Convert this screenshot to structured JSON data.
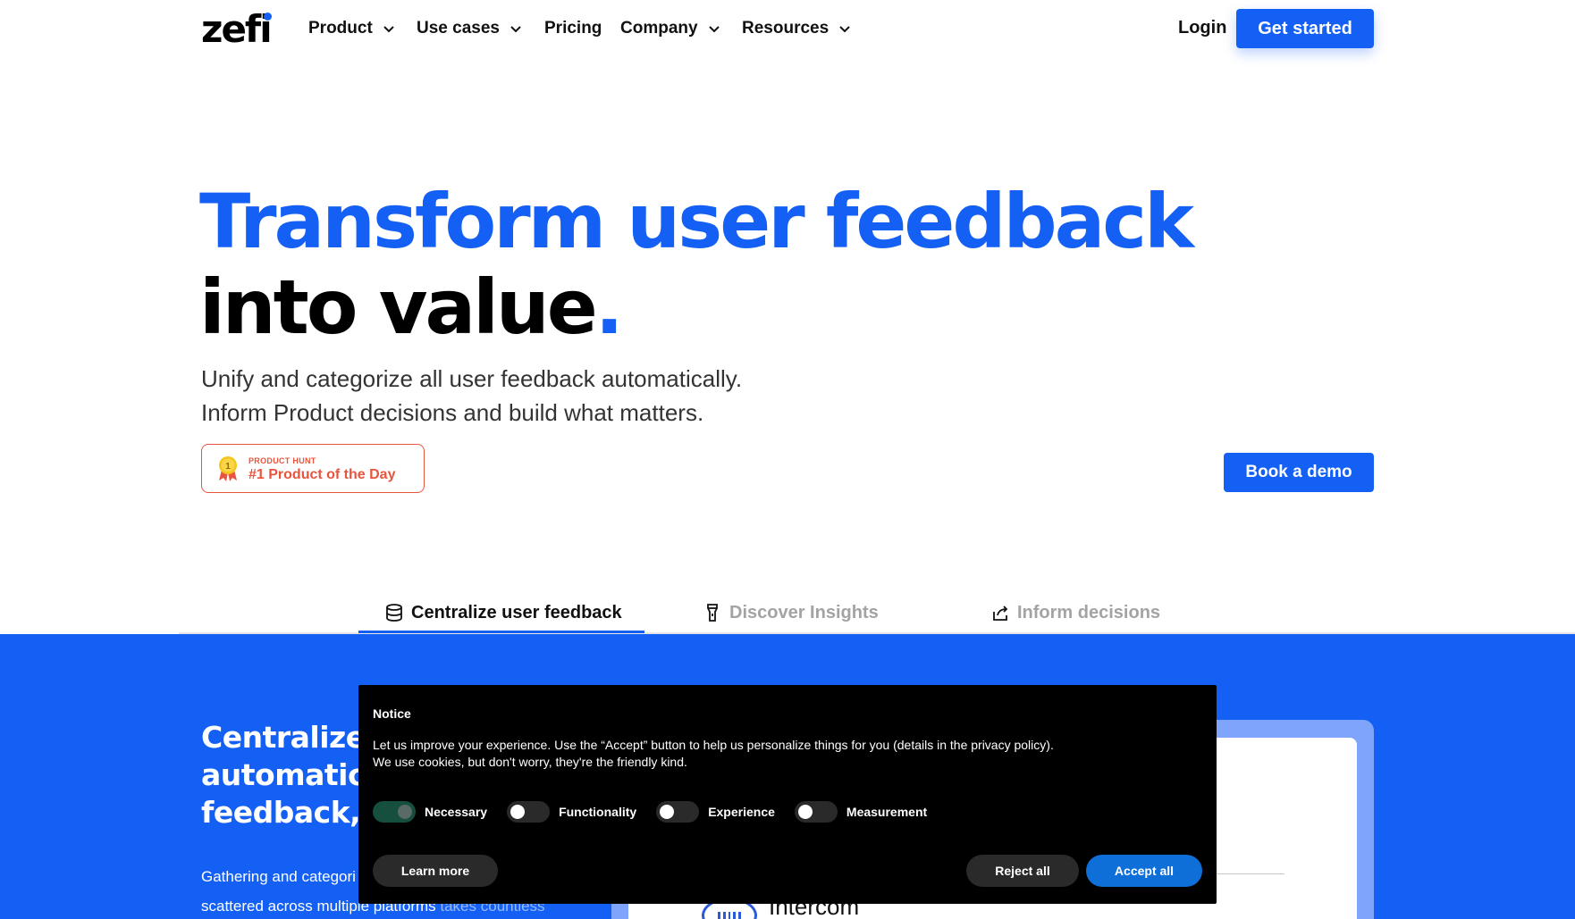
{
  "nav": {
    "logo": "zefi",
    "items": [
      {
        "label": "Product",
        "has_dropdown": true
      },
      {
        "label": "Use cases",
        "has_dropdown": true
      },
      {
        "label": "Pricing",
        "has_dropdown": false
      },
      {
        "label": "Company",
        "has_dropdown": true
      },
      {
        "label": "Resources",
        "has_dropdown": true
      }
    ],
    "login": "Login",
    "cta": "Get started"
  },
  "hero": {
    "headline_line1": "Transform user feedback",
    "headline_line2": "into value",
    "headline_period": ".",
    "subtitle_line1": "Unify and categorize all user feedback automatically.",
    "subtitle_line2": "Inform Product decisions and build what matters.",
    "badge_small": "PRODUCT HUNT",
    "badge_big": "#1 Product of the Day",
    "badge_medal_number": "1",
    "book_demo": "Book a demo"
  },
  "tabs": [
    {
      "label": "Centralize user feedback",
      "icon": "database-icon",
      "active": true
    },
    {
      "label": "Discover Insights",
      "icon": "flashlight-icon",
      "active": false
    },
    {
      "label": "Inform decisions",
      "icon": "share-icon",
      "active": false
    }
  ],
  "section": {
    "title_line1": "Centralize a",
    "title_line2": "automatical",
    "title_line3": "feedback, e",
    "text_line1": "Gathering and categori",
    "text_line2": "scattered across multiple platforms",
    "text_line2_faded": " takes countless",
    "integration_label": "Intercom"
  },
  "cookie_notice": {
    "title": "Notice",
    "text_line1": "Let us improve your experience. Use the “Accept” button to help us personalize things for you (details in the privacy policy).",
    "text_line2": "We use cookies, but don't worry, they're the friendly kind.",
    "toggles": [
      {
        "label": "Necessary",
        "on": true
      },
      {
        "label": "Functionality",
        "on": false
      },
      {
        "label": "Experience",
        "on": false
      },
      {
        "label": "Measurement",
        "on": false
      }
    ],
    "learn_more": "Learn more",
    "reject_all": "Reject all",
    "accept_all": "Accept all"
  },
  "colors": {
    "brand_blue": "#1460f5",
    "product_hunt": "#e8543d",
    "accept_blue": "#0f6fd8",
    "toggle_on": "#174f3e"
  }
}
